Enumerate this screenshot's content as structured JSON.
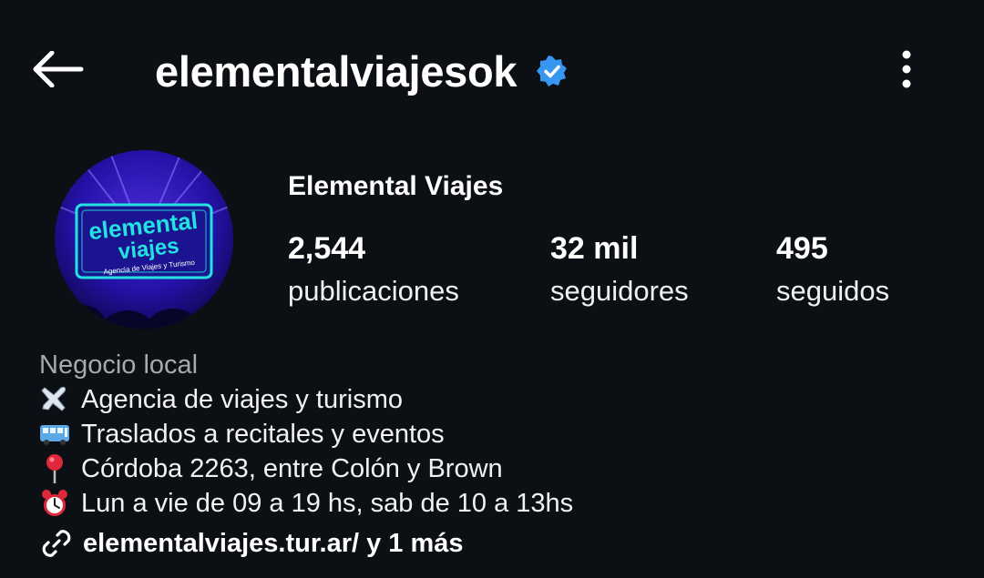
{
  "header": {
    "username": "elementalviajesok",
    "verified": true,
    "verified_color": "#3797f0",
    "back_icon": "arrow-left-icon",
    "menu_icon": "more-vertical-icon"
  },
  "profile": {
    "display_name": "Elemental Viajes",
    "avatar": {
      "line1": "elemental",
      "line2": "viajes",
      "tagline": "Agencia de Viajes y Turismo",
      "accent_color": "#22e3e0"
    },
    "stats": [
      {
        "value": "2,544",
        "label": "publicaciones"
      },
      {
        "value": "32 mil",
        "label": "seguidores"
      },
      {
        "value": "495",
        "label": "seguidos"
      }
    ]
  },
  "bio": {
    "category": "Negocio local",
    "lines": [
      {
        "icon": "airplane-icon",
        "text": "Agencia de viajes y turismo"
      },
      {
        "icon": "bus-icon",
        "text": "Traslados a recitales y eventos"
      },
      {
        "icon": "pin-icon",
        "text": "Córdoba 2263, entre Colón y Brown"
      },
      {
        "icon": "alarm-clock-icon",
        "text": "Lun a vie de 09 a 19 hs, sab de 10 a 13hs"
      }
    ],
    "link": {
      "icon": "link-icon",
      "text": "elementalviajes.tur.ar/ y 1 más"
    }
  }
}
